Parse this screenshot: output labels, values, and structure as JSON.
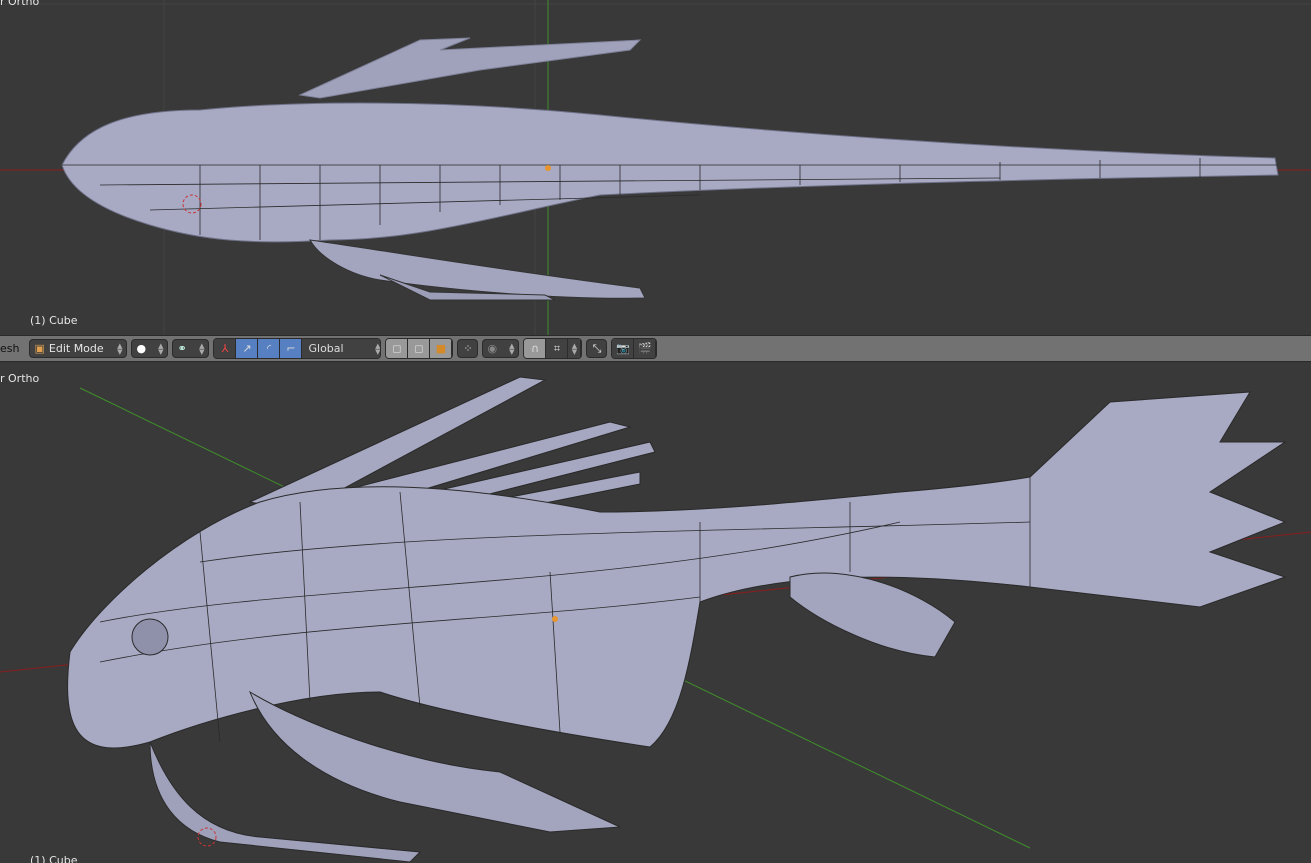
{
  "top_viewport": {
    "view_label": "r Ortho",
    "object_label": "(1) Cube"
  },
  "header": {
    "menu_fragment": "esh",
    "mode_label": "Edit Mode",
    "orientation_label": "Global",
    "icons": [
      "edit-mode-icon",
      "viewport-shading-icon",
      "pivot-point-icon",
      "manipulator-icon",
      "translate-icon",
      "rotate-icon",
      "scale-icon",
      "vertex-select-icon",
      "edge-select-icon",
      "face-select-icon",
      "limit-selection-icon",
      "proportional-edit-icon",
      "snap-icon",
      "snap-element-icon",
      "snap-target-icon",
      "render-icon",
      "render-animation-icon"
    ],
    "accent_color": "#5680c2"
  },
  "bottom_viewport": {
    "view_label": "r Ortho",
    "object_label": "(1) Cube"
  },
  "colors": {
    "background": "#393939",
    "mesh": "#a8aac4",
    "x_axis": "#8a1e1e",
    "y_axis": "#3f8f2a"
  }
}
